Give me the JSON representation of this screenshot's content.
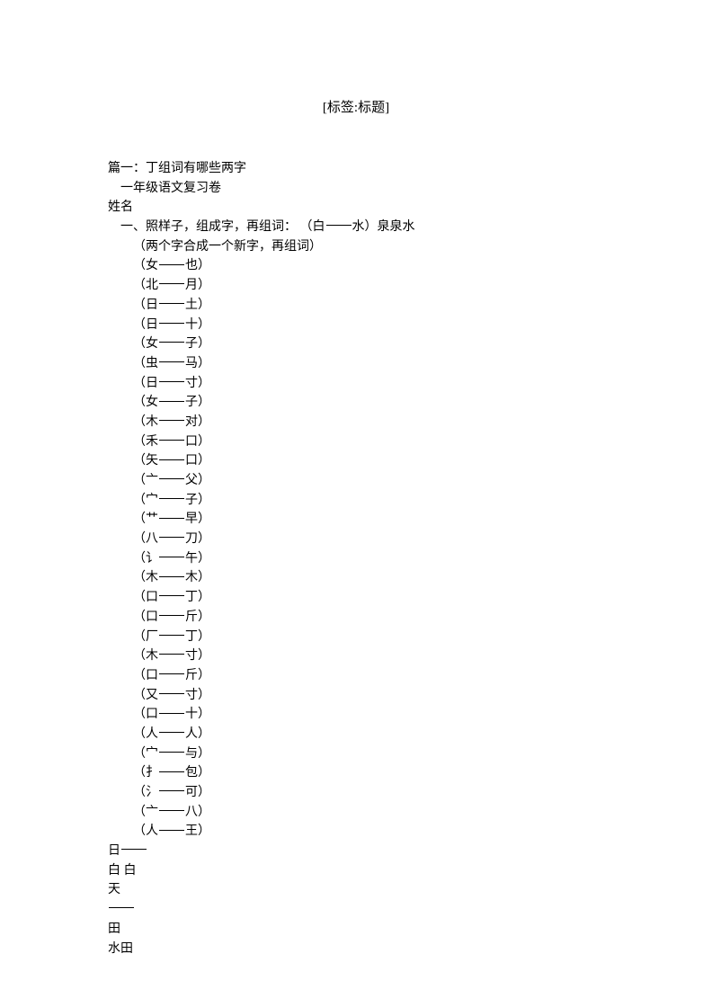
{
  "title": "[标签:标题]",
  "heading": "篇一：丁组词有哪些两字",
  "subtitle": "一年级语文复习卷",
  "name_label": "姓名",
  "section_title_pre": "一、照样子，组成字，再组词：   （白",
  "section_title_post": "水）泉泉水",
  "subnote": "（两个字合成一个新字，再组词）",
  "pairs": [
    {
      "left": "女",
      "right": "也"
    },
    {
      "left": "北",
      "right": "月"
    },
    {
      "left": "日",
      "right": "土"
    },
    {
      "left": "日",
      "right": "十"
    },
    {
      "left": "女",
      "right": "子"
    },
    {
      "left": "虫",
      "right": "马"
    },
    {
      "left": "日",
      "right": "寸"
    },
    {
      "left": "女",
      "right": "子"
    },
    {
      "left": "木",
      "right": "对"
    },
    {
      "left": "禾",
      "right": "口"
    },
    {
      "left": "矢",
      "right": "口"
    },
    {
      "left": "亠",
      "right": "父"
    },
    {
      "left": "宀",
      "right": "子"
    },
    {
      "left": "艹",
      "right": "早"
    },
    {
      "left": "八",
      "right": "刀"
    },
    {
      "left": "讠",
      "right": "午"
    },
    {
      "left": "木",
      "right": "木"
    },
    {
      "left": "口",
      "right": "丁"
    },
    {
      "left": "口",
      "right": "斤"
    },
    {
      "left": "厂",
      "right": "丁"
    },
    {
      "left": "木",
      "right": "寸"
    },
    {
      "left": "口",
      "right": "斤"
    },
    {
      "left": "又",
      "right": "寸"
    },
    {
      "left": "口",
      "right": "十"
    },
    {
      "left": "人",
      "right": "人"
    },
    {
      "left": "宀",
      "right": "与"
    },
    {
      "left": "扌",
      "right": "包"
    },
    {
      "left": "氵",
      "right": "可"
    },
    {
      "left": "亠",
      "right": "八"
    },
    {
      "left": "人",
      "right": "王"
    }
  ],
  "footer_lines": [
    "日",
    "白 白",
    "天",
    "",
    "田",
    "水田"
  ]
}
